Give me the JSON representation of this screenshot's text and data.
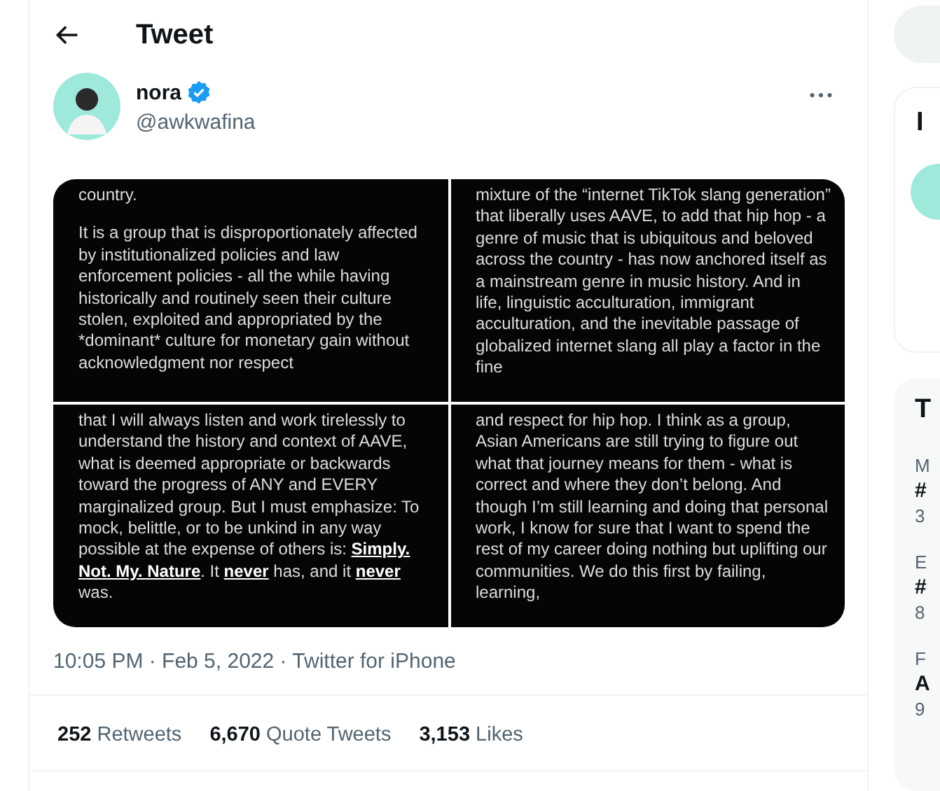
{
  "header": {
    "title": "Tweet"
  },
  "tweet": {
    "author": {
      "name": "nora",
      "verified": true,
      "handle": "@awkwafina"
    },
    "images": [
      {
        "paragraphs": [
          "country.",
          "It is a group that is disproportionately affected by institutionalized policies and law enforcement policies - all the while having historically and routinely seen their culture stolen, exploited and appropriated by the *dominant* culture for monetary gain without acknowledgment nor respect"
        ],
        "kind": "plain"
      },
      {
        "paragraphs": [
          "mixture of the  “internet TikTok slang generation” that liberally uses AAVE, to add that hip hop - a genre of music that is ubiquitous and beloved across the country - has now anchored itself as a mainstream genre in music history. And in life, linguistic acculturation,  immigrant acculturation, and the inevitable passage of globalized internet slang all play a factor in the fine"
        ],
        "kind": "plain"
      },
      {
        "paragraphs": [
          "that I will always listen and work tirelessly to understand the history and context of AAVE, what is deemed appropriate or backwards toward the progress of ANY and EVERY marginalized group.  But I must emphasize: To mock, belittle, or to be unkind in any way possible at the expense of others is: **Simply. Not. My. Nature**. It **never** has, and it **never** was."
        ],
        "kind": "rich"
      },
      {
        "paragraphs": [
          "and respect for hip hop. I think as a group, Asian Americans are still trying to figure out what that journey means for them - what is correct and where they don’t belong. And though I’m still learning and doing that personal work, I know for sure that  I want to spend the rest of my career doing nothing but uplifting our communities. We do this first by failing, learning,"
        ],
        "kind": "plain"
      }
    ],
    "timestamp": "10:05 PM · Feb 5, 2022 · Twitter for iPhone",
    "stats": [
      {
        "count": "252",
        "label": "Retweets"
      },
      {
        "count": "6,670",
        "label": "Quote Tweets"
      },
      {
        "count": "3,153",
        "label": "Likes"
      }
    ]
  },
  "sidebar": {
    "card_title": "I",
    "trends_title": "T",
    "trends": [
      {
        "context": "M",
        "name": "#",
        "count": "3"
      },
      {
        "context": "E",
        "name": "#",
        "count": "8"
      },
      {
        "context": "F",
        "name": "A",
        "count": "9"
      }
    ]
  }
}
